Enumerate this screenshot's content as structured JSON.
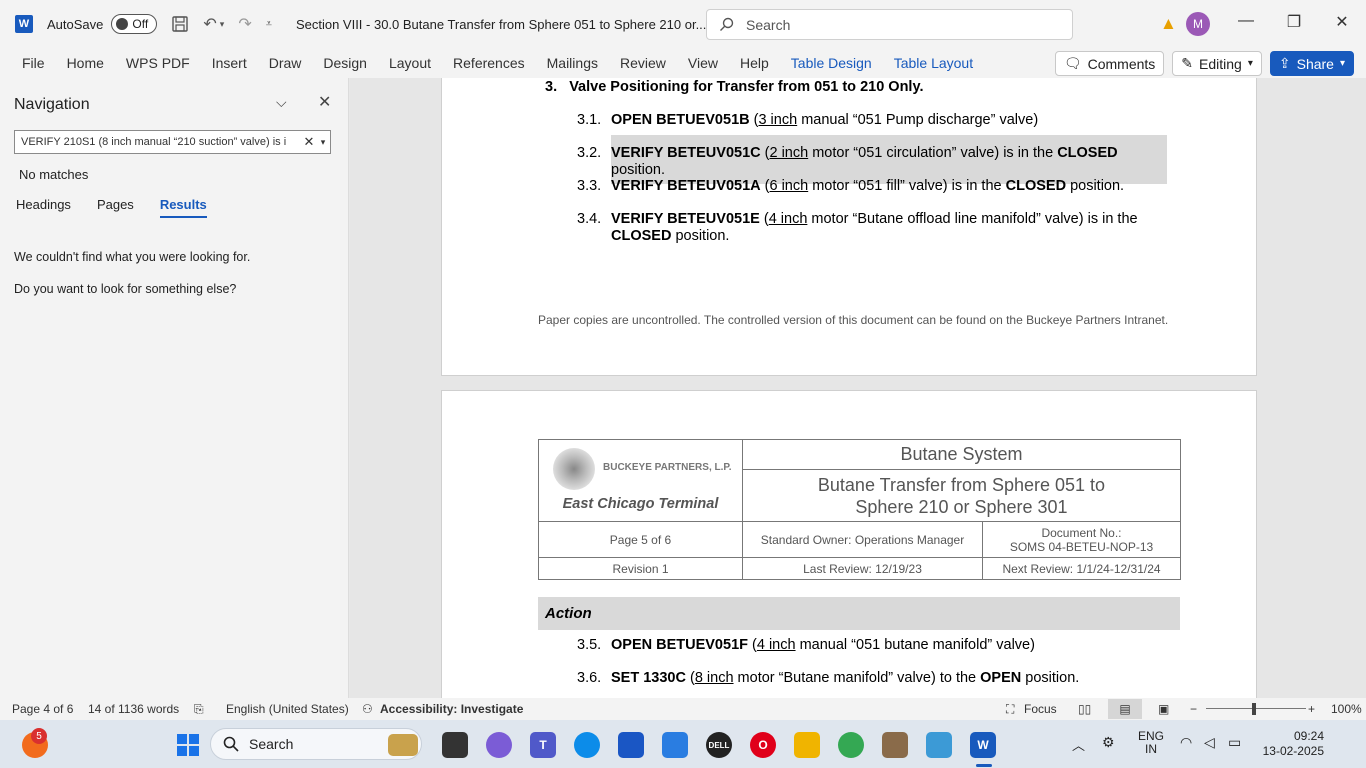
{
  "titlebar": {
    "app_logo": "W",
    "autosave_label": "AutoSave",
    "autosave_state": "Off",
    "doc_title": "Section VIII - 30.0 Butane Transfer from Sphere 051 to Sphere 210 or...",
    "search_placeholder": "Search",
    "avatar_initial": "M"
  },
  "ribbon": {
    "tabs": [
      "File",
      "Home",
      "WPS PDF",
      "Insert",
      "Draw",
      "Design",
      "Layout",
      "References",
      "Mailings",
      "Review",
      "View",
      "Help"
    ],
    "contextual_tabs": [
      "Table Design",
      "Table Layout"
    ],
    "comments_label": "Comments",
    "editing_label": "Editing",
    "share_label": "Share"
  },
  "navigation": {
    "title": "Navigation",
    "search_value": "VERIFY 210S1 (8 inch manual “210 suction” valve) is i",
    "no_matches": "No matches",
    "tabs": [
      "Headings",
      "Pages",
      "Results"
    ],
    "message1": "We couldn't find what you were looking for.",
    "message2": "Do you want to look for something else?"
  },
  "document": {
    "step3_num": "3.",
    "step3_title": "Valve Positioning for Transfer from 051 to 210 Only.",
    "steps": [
      {
        "num": "3.1.",
        "b1": "OPEN BETUEV051B",
        "p1": " (",
        "u": "3 inch",
        "p2": " manual “051 Pump discharge” valve)"
      },
      {
        "num": "3.2.",
        "b1": "VERIFY BETEUV051C",
        "p1": " (",
        "u": "2 inch",
        "p2": " motor “051 circulation” valve) is in the ",
        "b2": "CLOSED",
        "p3": " position."
      },
      {
        "num": "3.3.",
        "b1": "VERIFY BETEUV051A",
        "p1": " (",
        "u": "6 inch",
        "p2": " motor “051 fill” valve) is in the ",
        "b2": "CLOSED",
        "p3": " position."
      },
      {
        "num": "3.4.",
        "b1": "VERIFY BETEUV051E",
        "p1": " (",
        "u": "4 inch",
        "p2": " motor “Butane offload line manifold” valve) is in the ",
        "b2": "CLOSED",
        "p3": " position."
      },
      {
        "num": "3.5.",
        "b1": "OPEN BETUEV051F",
        "p1": " (",
        "u": "4 inch",
        "p2": " manual “051 butane manifold” valve)"
      },
      {
        "num": "3.6.",
        "b1": "SET 1330C",
        "p1": " (",
        "u": "8 inch",
        "p2": " motor “Butane manifold” valve) to the ",
        "b2": "OPEN",
        "p3": " position."
      }
    ],
    "footer_note": "Paper copies are uncontrolled. The controlled version of this document can be found on the Buckeye Partners Intranet.",
    "header": {
      "logo_text": "BUCKEYE PARTNERS, L.P.",
      "terminal": "East Chicago Terminal",
      "system": "Butane System",
      "procedure_line1": "Butane Transfer from Sphere 051 to",
      "procedure_line2": "Sphere 210 or Sphere 301",
      "page": "Page 5 of 6",
      "owner": "Standard Owner: Operations Manager",
      "docno_label": "Document No.:",
      "docno": "SOMS 04-BETEU-NOP-13",
      "revision": "Revision 1",
      "last_review": "Last Review: 12/19/23",
      "next_review": "Next Review: 1/1/24-12/31/24"
    },
    "action_label": "Action"
  },
  "statusbar": {
    "page": "Page 4 of 6",
    "words": "14 of 1136 words",
    "language": "English (United States)",
    "accessibility": "Accessibility: Investigate",
    "focus": "Focus",
    "zoom": "100%"
  },
  "taskbar": {
    "badge": "5",
    "search": "Search",
    "lang1": "ENG",
    "lang2": "IN",
    "time": "09:24",
    "date": "13-02-2025"
  }
}
